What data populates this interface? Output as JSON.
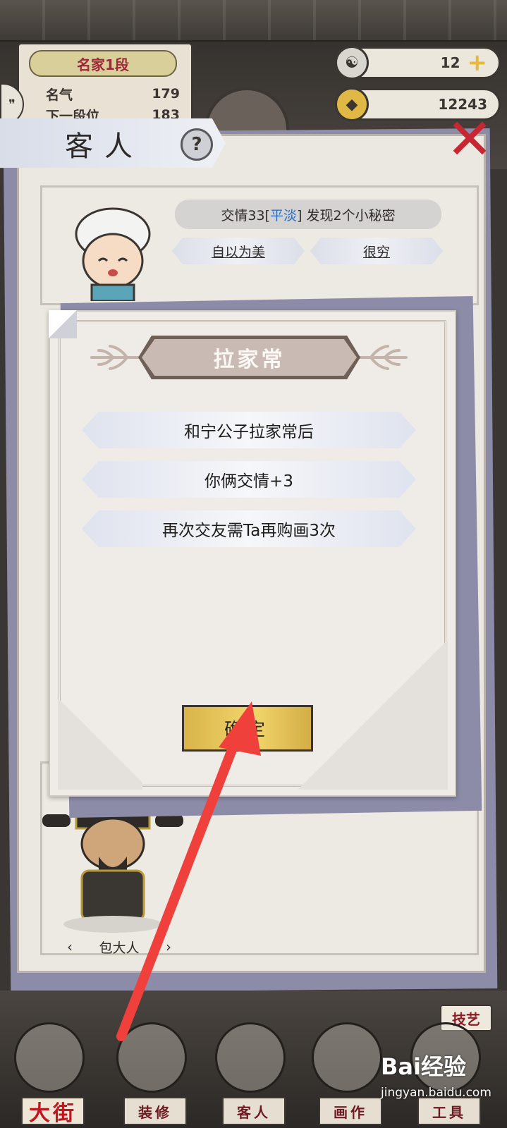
{
  "rank": {
    "badge": "名家1段",
    "fame_label": "名气",
    "fame_value": "179",
    "next_label": "下一段位",
    "next_value": "183"
  },
  "resources": {
    "jade": "12",
    "coins": "12243"
  },
  "guest_panel": {
    "title": "客人",
    "help": "?",
    "relation": {
      "prefix": "交情33[",
      "level": "平淡",
      "suffix": "] 发现2个小秘密"
    },
    "traits": [
      "自以为美",
      "很穷"
    ],
    "second_guest_name": "包大人"
  },
  "dialog": {
    "title": "拉家常",
    "lines": [
      "和宁公子拉家常后",
      "你俩交情+3",
      "再次交友需Ta再购画3次"
    ],
    "confirm_label": "确定"
  },
  "bottom_nav": {
    "skill_tag": "技艺",
    "items": [
      {
        "label": "大街",
        "icon": "street-gate-icon"
      },
      {
        "label": "装修",
        "icon": "decorate-book-icon"
      },
      {
        "label": "客人",
        "icon": "guest-girl-icon"
      },
      {
        "label": "画作",
        "icon": "painting-scroll-icon"
      },
      {
        "label": "工具",
        "icon": "tools-icon"
      }
    ]
  },
  "colors": {
    "accent_red": "#c72733",
    "relation_level_blue": "#2b6fc7",
    "confirm_gold": "#f2d66c",
    "annotation_arrow": "#f0403c"
  },
  "watermark": {
    "logo": "Bai经验",
    "url": "jingyan.baidu.com"
  }
}
